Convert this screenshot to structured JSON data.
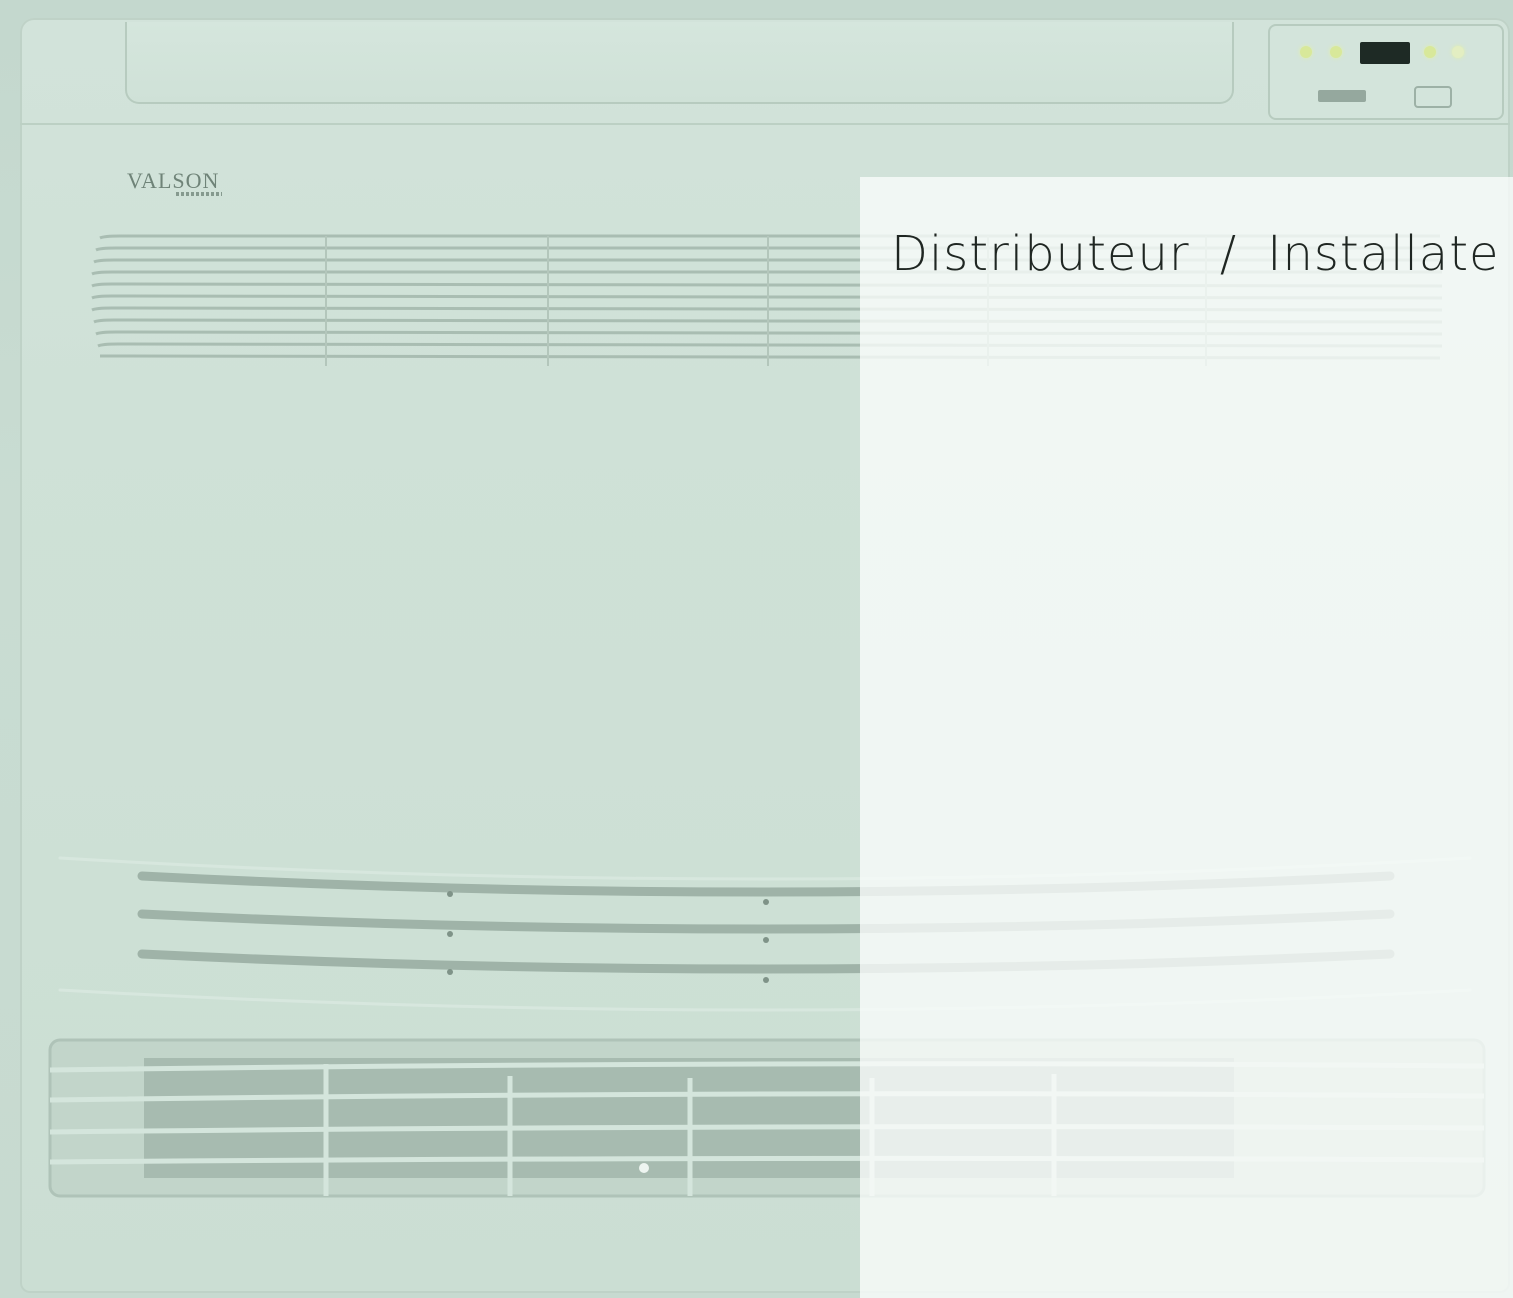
{
  "brand": {
    "name": "VALSON",
    "icon": "brand-logo"
  },
  "overlay": {
    "label": "Distributeur / Installate"
  },
  "colors": {
    "background_tint": "#c9dcd2",
    "overlay": "#f5f8f6",
    "led": "#d8e89a",
    "display": "#1e2a25",
    "label_text": "#1f2622"
  }
}
